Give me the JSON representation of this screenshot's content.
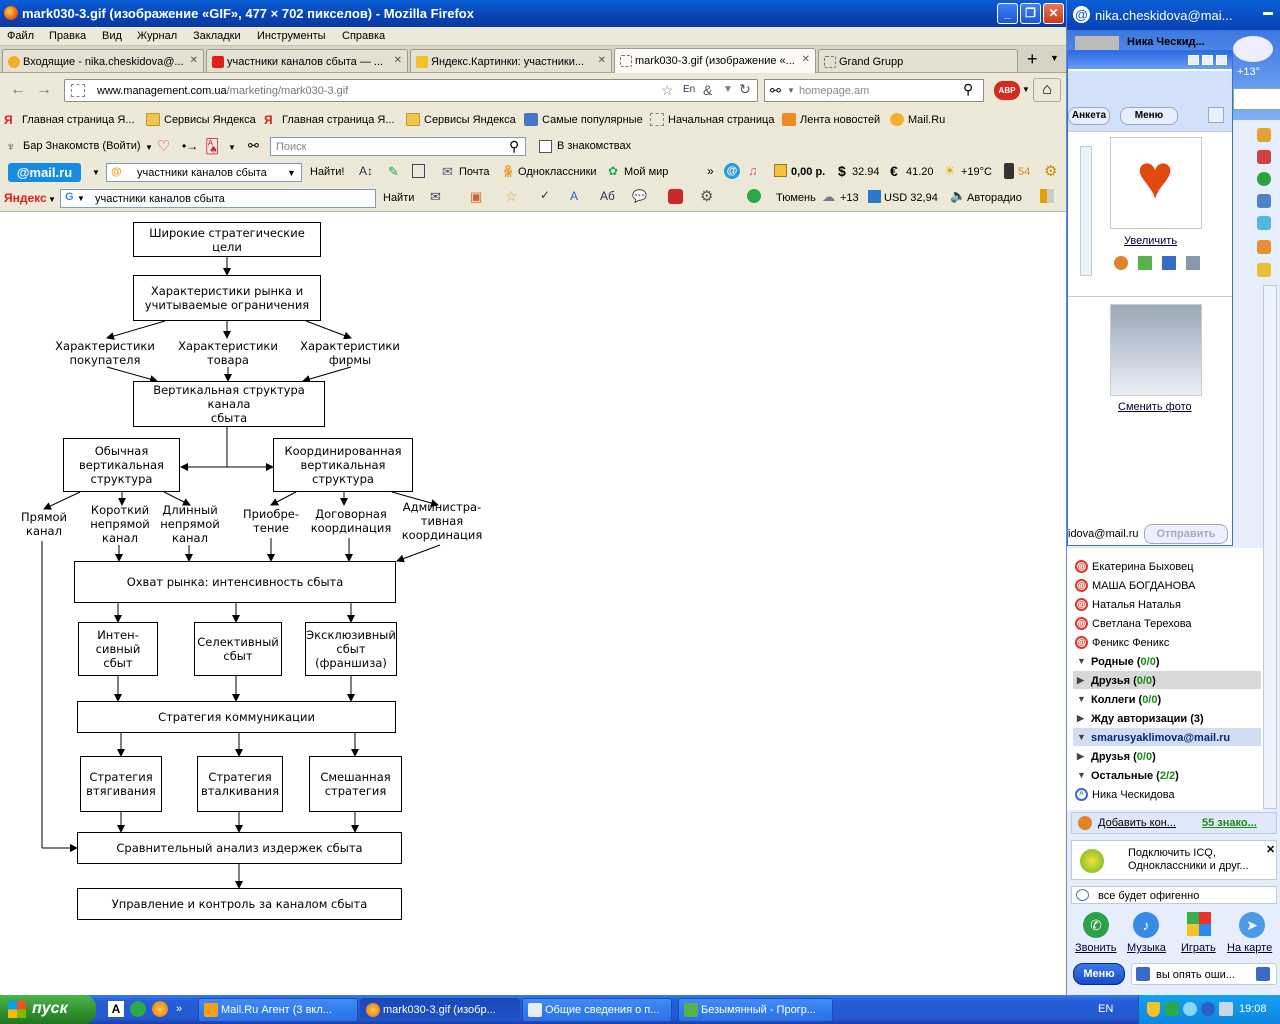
{
  "window": {
    "title": "mark030-3.gif (изображение «GIF», 477 × 702 пикселов) - Mozilla Firefox"
  },
  "menu": [
    "Файл",
    "Правка",
    "Вид",
    "Журнал",
    "Закладки",
    "Инструменты",
    "Справка"
  ],
  "tabs": [
    {
      "label": "Входящие - nika.cheskidova@..."
    },
    {
      "label": "участники каналов сбыта — ..."
    },
    {
      "label": "Яндекс.Картинки: участники..."
    },
    {
      "label": "mark030-3.gif (изображение «..."
    },
    {
      "label": "Grand Grupp"
    }
  ],
  "nav": {
    "url_domain": "www.management.com.ua",
    "url_path": "/marketing/mark030-3.gif",
    "search_placeholder": "homepage.am"
  },
  "bookmarks": [
    "Главная страница Я...",
    "Сервисы Яндекса",
    "Главная страница Я...",
    "Сервисы Яндекса",
    "Самые популярные",
    "Начальная страница",
    "Лента новостей",
    "Mail.Ru"
  ],
  "toolbar2": {
    "bar_label": "Бар Знакомств (Войти)",
    "search_placeholder": "Поиск",
    "check_label": "В знакомствах"
  },
  "toolbar3": {
    "logo": "@mail.ru",
    "query": "участники каналов сбыта",
    "find": "Найти!",
    "mail": "Почта",
    "ok": "Одноклассники",
    "myworld": "Мой мир",
    "money": "0,00 р.",
    "usd": "32.94",
    "eur": "41.20",
    "weather": "+19°C",
    "traffic": "54"
  },
  "toolbar4": {
    "logo": "Яндекс",
    "query": "участники каналов сбыта",
    "find": "Найти",
    "city": "Тюмень",
    "temp": "+13",
    "usd": "USD 32,94",
    "radio": "Авторадио"
  },
  "diagram": {
    "goals": "Широкие стратегические цели",
    "market": "Характеристики рынка и\nучитываемые ограничения",
    "buyer": "Характеристики\nпокупателя",
    "product": "Характеристики\nтовара",
    "firm": "Характеристики\nфирмы",
    "vertical": "Вертикальная структура канала\nсбыта",
    "ordinary": "Обычная\nвертикальная\nструктура",
    "coordinated": "Координированная\nвертикальная\nструктура",
    "direct": "Прямой\nканал",
    "short": "Короткий\nнепрямой\nканал",
    "long": "Длинный\nнепрямой\nканал",
    "acquisition": "Приобре-\nтение",
    "contractual": "Договорная\nкоординация",
    "administrative": "Администра-\nтивная\nкоординация",
    "coverage": "Охват рынка: интенсивность сбыта",
    "intensive": "Интен-\nсивный\nсбыт",
    "selective": "Селективный\nсбыт",
    "exclusive": "Эксклюзивный\nсбыт\n(франшиза)",
    "comm": "Стратегия коммуникации",
    "pull": "Стратегия\nвтягивания",
    "push": "Стратегия\nвталкивания",
    "mixed": "Смешанная\nстратегия",
    "costs": "Сравнительный анализ издержек сбыта",
    "control": "Управление и контроль за каналом сбыта"
  },
  "agent": {
    "title": "nika.cheskidova@mai...",
    "user": "Ника Ческид...",
    "temp": "+13°",
    "popup": {
      "anketa": "Анкета",
      "menu": "Меню",
      "zoom": "Увеличить",
      "change_photo": "Сменить фото",
      "email_partial": "idova@mail.ru",
      "send": "Отправить"
    },
    "contacts": [
      "Екатерина Быховец",
      "МАША БОГДАНОВА",
      "Наталья Наталья",
      "Светлана Терехова",
      "Феникс Феникс"
    ],
    "groups1": [
      {
        "name": "Родные",
        "count": "0/0"
      },
      {
        "name": "Друзья",
        "count": "0/0"
      },
      {
        "name": "Коллеги",
        "count": "0/0"
      },
      {
        "name": "Жду авторизации",
        "count": "3"
      }
    ],
    "account2": "smarusyaklimova@mail.ru",
    "groups2": [
      {
        "name": "Друзья",
        "count": "0/0"
      },
      {
        "name": "Остальные",
        "count": "2/2"
      }
    ],
    "self_contact": "Ника Ческидова",
    "add_contact": "Добавить кон...",
    "acquaint": "55 знако...",
    "icq_promo": "Подключить ICQ,\nОдноклассники и друг...",
    "status": "все будет офигенно",
    "actions": [
      "Звонить",
      "Музыка",
      "Играть",
      "На карте"
    ],
    "menu_btn": "Меню",
    "bottom_status": "вы опять оши..."
  },
  "taskbar": {
    "start": "пуск",
    "items": [
      "Mail.Ru Агент (3 вкл...",
      "mark030-3.gif (изобр...",
      "Общие сведения о п...",
      "Безымянный - Прогр..."
    ],
    "lang": "EN",
    "clock": "19:08"
  }
}
